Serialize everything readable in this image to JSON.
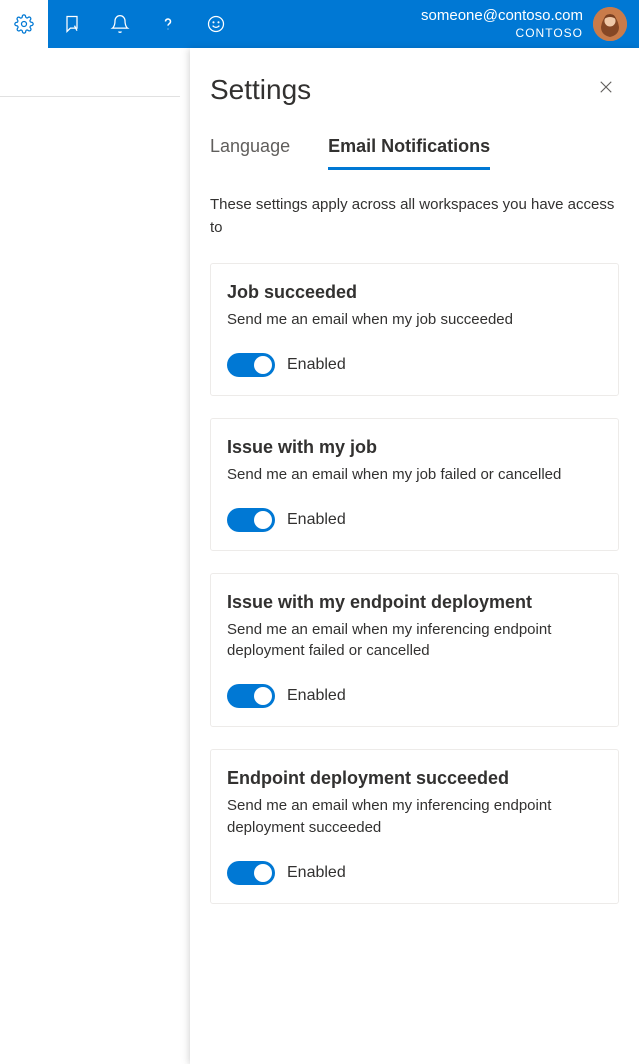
{
  "header": {
    "user_email": "someone@contoso.com",
    "tenant": "CONTOSO"
  },
  "panel": {
    "title": "Settings",
    "tabs": [
      {
        "label": "Language",
        "active": false
      },
      {
        "label": "Email Notifications",
        "active": true
      }
    ],
    "description": "These settings apply across all workspaces you have access to",
    "cards": [
      {
        "title": "Job succeeded",
        "desc": "Send me an email when my job succeeded",
        "state_label": "Enabled"
      },
      {
        "title": "Issue with my job",
        "desc": "Send me an email when my job failed or cancelled",
        "state_label": "Enabled"
      },
      {
        "title": "Issue with my endpoint deployment",
        "desc": "Send me an email when my inferencing endpoint deployment failed or cancelled",
        "state_label": "Enabled"
      },
      {
        "title": "Endpoint deployment succeeded",
        "desc": "Send me an email when my inferencing endpoint deployment succeeded",
        "state_label": "Enabled"
      }
    ]
  }
}
